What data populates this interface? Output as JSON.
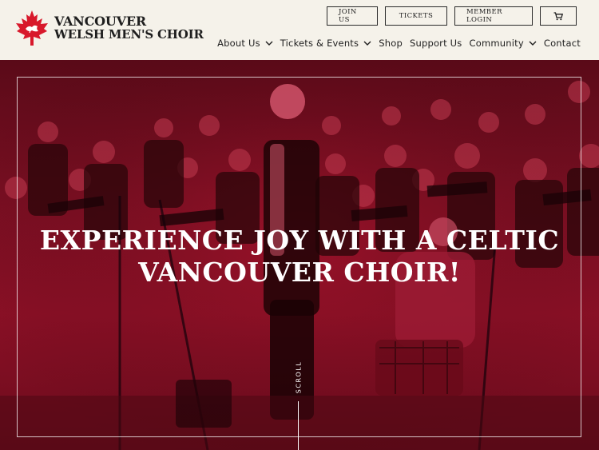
{
  "brand": {
    "line1": "VANCOUVER",
    "line2": "WELSH MEN'S CHOIR",
    "logo_icon": "maple-leaf-dragon-logo",
    "accent": "#d8182b"
  },
  "top_buttons": {
    "join": "JOIN US",
    "tickets": "TICKETS",
    "member_login": "MEMBER LOGIN",
    "cart_icon": "cart-icon"
  },
  "nav": {
    "items": [
      {
        "label": "About Us",
        "has_dropdown": true
      },
      {
        "label": "Tickets & Events",
        "has_dropdown": true
      },
      {
        "label": "Shop",
        "has_dropdown": false
      },
      {
        "label": "Support Us",
        "has_dropdown": false
      },
      {
        "label": "Community",
        "has_dropdown": true
      },
      {
        "label": "Contact",
        "has_dropdown": false
      }
    ]
  },
  "hero": {
    "headline_line1": "EXPERIENCE JOY WITH A CELTIC",
    "headline_line2": "VANCOUVER CHOIR!",
    "scroll_label": "SCROLL",
    "overlay_color": "#8c1026"
  }
}
